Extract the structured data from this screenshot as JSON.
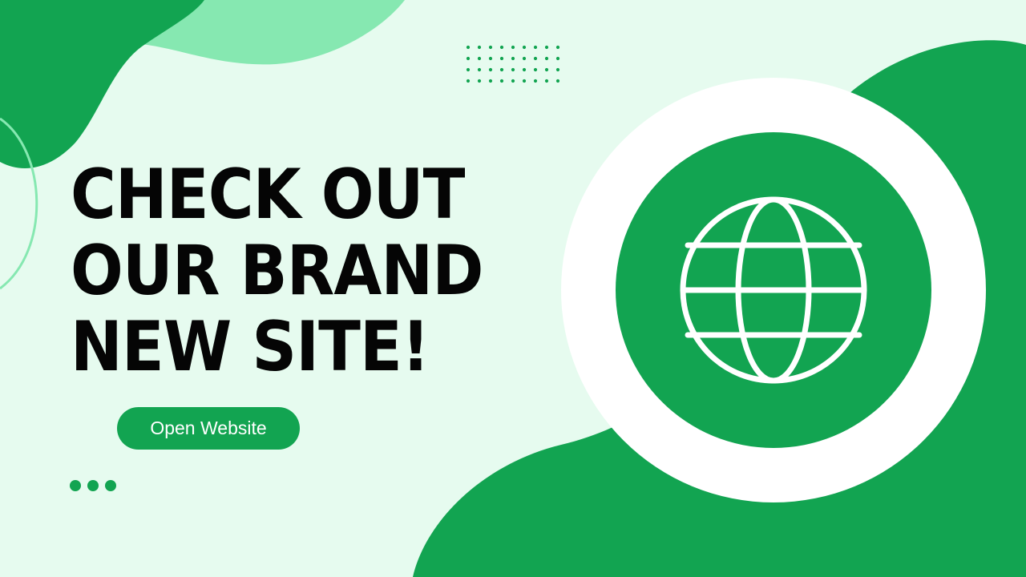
{
  "headline": {
    "line1": "CHECK OUT",
    "line2": "OUR BRAND",
    "line3": "NEW SITE!"
  },
  "cta": {
    "label": "Open Website"
  },
  "icons": {
    "globe": "globe-icon",
    "dot_grid": "dot-grid-decoration",
    "pagination_dots": "pagination-dots-icon"
  },
  "colors": {
    "background": "#e6fbef",
    "primary_green": "#12a451",
    "light_green": "#86e8b1",
    "text": "#050505",
    "white": "#ffffff"
  }
}
